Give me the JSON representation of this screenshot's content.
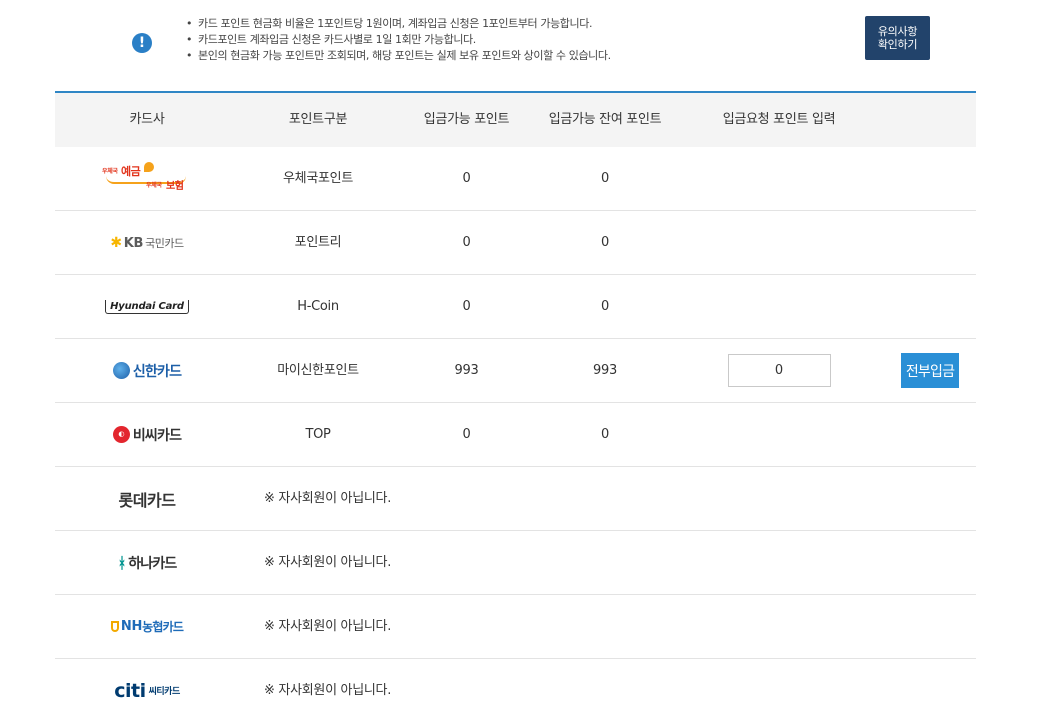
{
  "notice": {
    "icon": "info-icon",
    "items": [
      "카드 포인트 현금화 비율은 1포인트당 1원이며, 계좌입금 신청은 1포인트부터 가능합니다.",
      "카드포인트 계좌입금 신청은 카드사별로 1일 1회만 가능합니다.",
      "본인의 현금화 가능 포인트만 조회되며, 해당 포인트는 실제 보유 포인트와 상이할 수 있습니다."
    ],
    "button_line1": "유의사항",
    "button_line2": "확인하기",
    "button_color": "#22436b"
  },
  "table": {
    "accent_color": "#2f86c5",
    "headers": [
      "카드사",
      "포인트구분",
      "입금가능 포인트",
      "입금가능 잔여 포인트",
      "입금요청 포인트 입력"
    ],
    "rows": [
      {
        "card": "우체국 예금 / 우체국 보험",
        "logo": "epost-logo",
        "type": "우체국포인트",
        "available": "0",
        "remaining": "0"
      },
      {
        "card": "KB국민카드",
        "logo": "kb-logo",
        "type": "포인트리",
        "available": "0",
        "remaining": "0"
      },
      {
        "card": "Hyundai Card",
        "logo": "hyundai-logo",
        "type": "H-Coin",
        "available": "0",
        "remaining": "0"
      },
      {
        "card": "신한카드",
        "logo": "shinhan-logo",
        "type": "마이신한포인트",
        "available": "993",
        "remaining": "993",
        "input_value": "0",
        "action_label": "전부입금"
      },
      {
        "card": "비씨카드",
        "logo": "bc-logo",
        "type": "TOP",
        "available": "0",
        "remaining": "0"
      },
      {
        "card": "롯데카드",
        "logo": "lotte-logo",
        "note": "※ 자사회원이 아닙니다."
      },
      {
        "card": "하나카드",
        "logo": "hana-logo",
        "note": "※ 자사회원이 아닙니다."
      },
      {
        "card": "NH농협카드",
        "logo": "nh-logo",
        "note": "※ 자사회원이 아닙니다."
      },
      {
        "card": "citi 씨티카드",
        "logo": "citi-logo",
        "note": "※ 자사회원이 아닙니다."
      }
    ]
  },
  "logo_text": {
    "epost_top": "우체국",
    "epost_top_big": "예금",
    "epost_bottom": "우체국",
    "epost_bottom_big": "보험",
    "kb_mark": "KB",
    "kb_name": "국민카드",
    "hyundai": "Hyundai Card",
    "shinhan": "신한카드",
    "bc": "비씨카드",
    "lotte": "롯데카드",
    "hana": "하나카드",
    "nh_mark": "NH",
    "nh_name": "농협카드",
    "citi_mark": "citi",
    "citi_name": "씨티카드"
  }
}
